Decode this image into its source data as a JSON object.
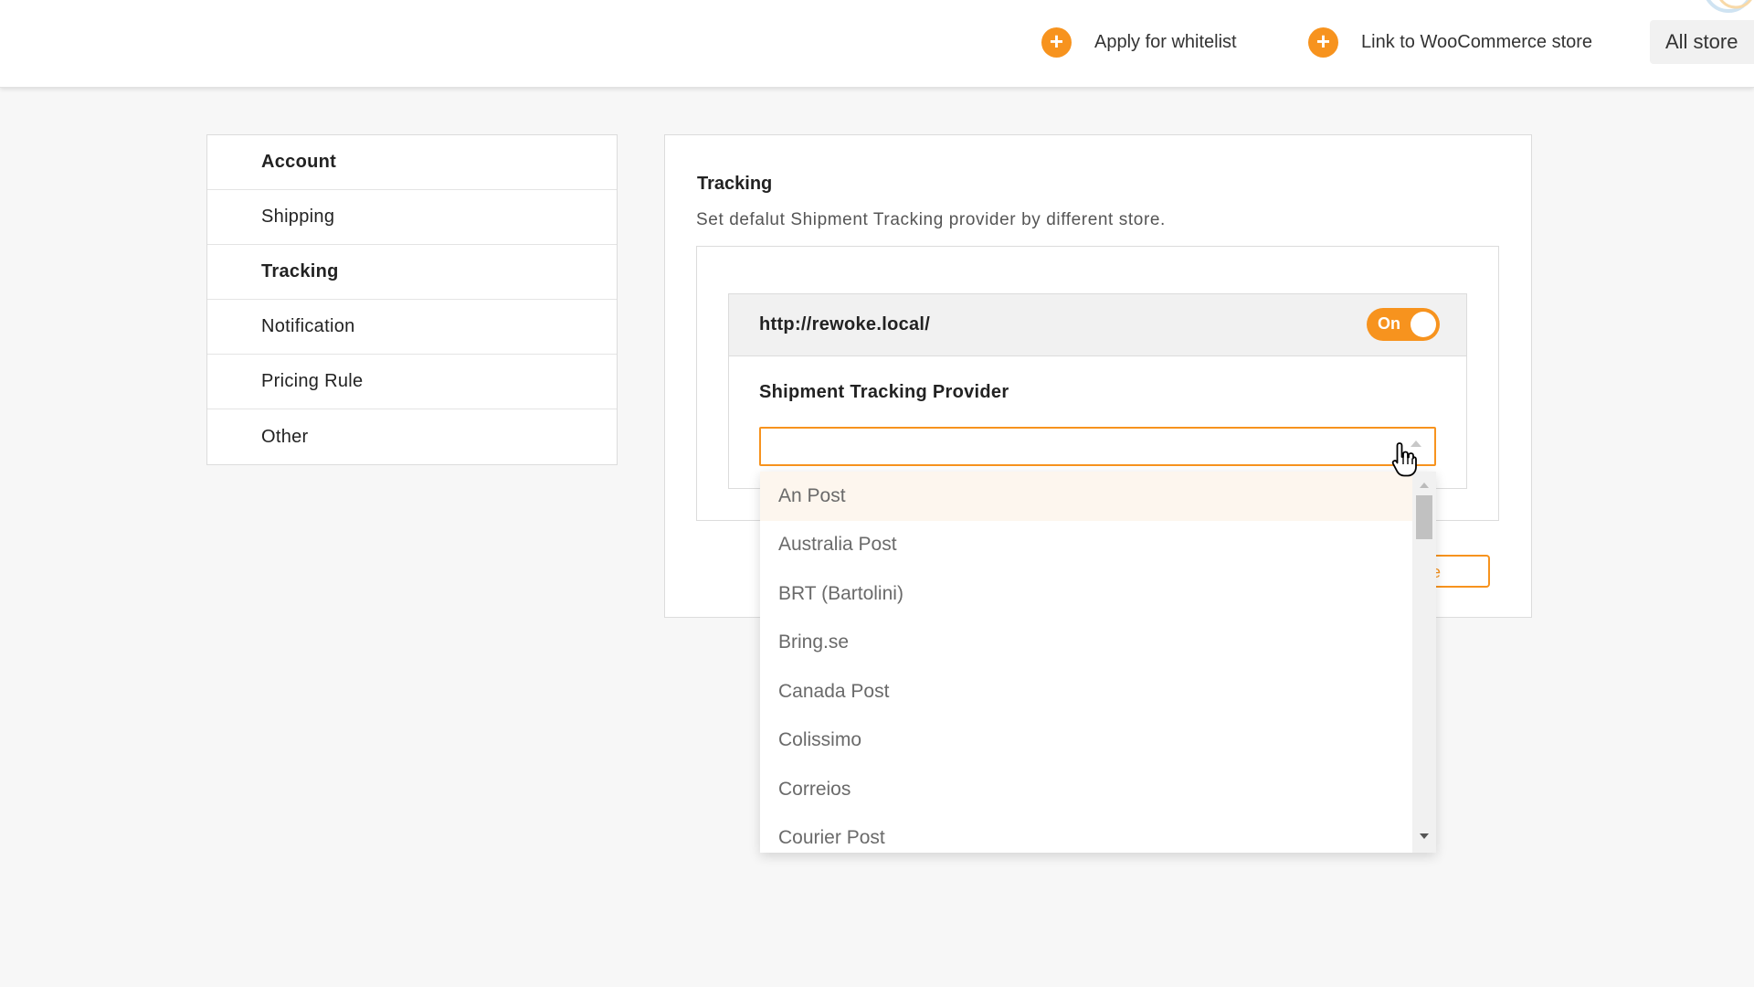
{
  "header": {
    "actions": [
      {
        "label": "Apply for whitelist",
        "icon": "plus-circle-icon"
      },
      {
        "label": "Link to WooCommerce store",
        "icon": "plus-circle-icon"
      }
    ],
    "store_selector": "All store",
    "accent_color": "#f7931e"
  },
  "sidebar": {
    "items": [
      {
        "label": "Account"
      },
      {
        "label": "Shipping"
      },
      {
        "label": "Tracking"
      },
      {
        "label": "Notification"
      },
      {
        "label": "Pricing Rule"
      },
      {
        "label": "Other"
      }
    ]
  },
  "main": {
    "title": "Tracking",
    "description": "Set defalut Shipment Tracking provider by different store.",
    "store": {
      "url": "http://rewoke.local/",
      "toggle_label": "On",
      "toggle_on": true
    },
    "provider": {
      "label": "Shipment Tracking Provider",
      "selected_value": "",
      "options": [
        "An Post",
        "Australia Post",
        "BRT (Bartolini)",
        "Bring.se",
        "Canada Post",
        "Colissimo",
        "Correios",
        "Courier Post"
      ],
      "highlighted": "An Post"
    },
    "save_button_visible_fragment": "e"
  }
}
